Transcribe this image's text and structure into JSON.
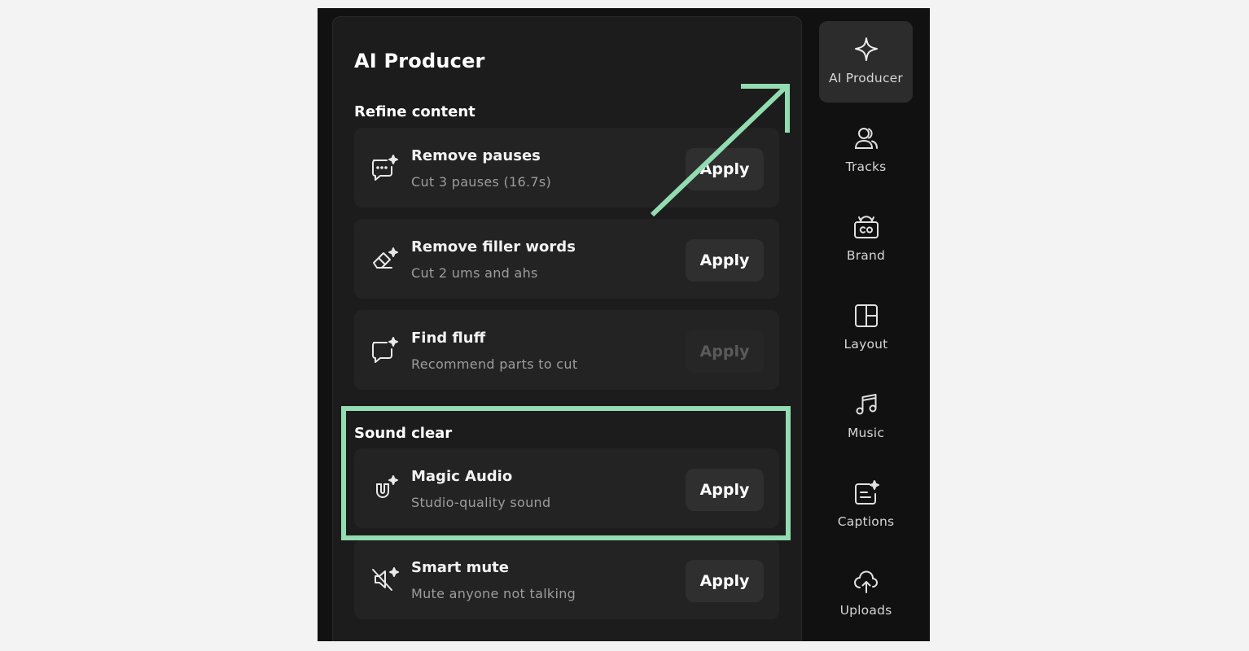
{
  "panel": {
    "title": "AI Producer",
    "sections": [
      {
        "title": "Refine content",
        "cards": [
          {
            "title": "Remove pauses",
            "subtitle": "Cut 3 pauses (16.7s)",
            "button": "Apply",
            "icon": "sparkle-chat-dots-icon",
            "enabled": true
          },
          {
            "title": "Remove filler words",
            "subtitle": "Cut 2 ums and ahs",
            "button": "Apply",
            "icon": "sparkle-eraser-icon",
            "enabled": true
          },
          {
            "title": "Find fluff",
            "subtitle": "Recommend parts to cut",
            "button": "Apply",
            "icon": "sparkle-chat-icon",
            "enabled": false
          }
        ]
      },
      {
        "title": "Sound clear",
        "cards": [
          {
            "title": "Magic Audio",
            "subtitle": "Studio-quality sound",
            "button": "Apply",
            "icon": "sparkle-magnet-icon",
            "enabled": true
          },
          {
            "title": "Smart mute",
            "subtitle": "Mute anyone not talking",
            "button": "Apply",
            "icon": "sparkle-mute-icon",
            "enabled": true
          }
        ]
      }
    ]
  },
  "sidebar": {
    "items": [
      {
        "label": "AI Producer",
        "icon": "sparkle-icon",
        "active": true
      },
      {
        "label": "Tracks",
        "icon": "users-icon",
        "active": false
      },
      {
        "label": "Brand",
        "icon": "brand-kit-icon",
        "active": false
      },
      {
        "label": "Layout",
        "icon": "layout-icon",
        "active": false
      },
      {
        "label": "Music",
        "icon": "music-note-icon",
        "active": false
      },
      {
        "label": "Captions",
        "icon": "captions-icon",
        "active": false
      },
      {
        "label": "Uploads",
        "icon": "cloud-upload-icon",
        "active": false
      }
    ]
  },
  "annotation": {
    "color": "#93dbb1"
  }
}
